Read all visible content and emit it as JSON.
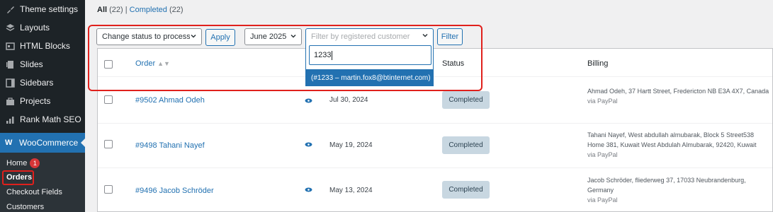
{
  "sidebar": {
    "items": [
      {
        "icon": "brush-icon",
        "label": "Theme settings"
      },
      {
        "icon": "layers-icon",
        "label": "Layouts"
      },
      {
        "icon": "html-blocks-icon",
        "label": "HTML Blocks"
      },
      {
        "icon": "slides-icon",
        "label": "Slides"
      },
      {
        "icon": "sidebars-icon",
        "label": "Sidebars"
      },
      {
        "icon": "projects-icon",
        "label": "Projects"
      },
      {
        "icon": "chart-icon",
        "label": "Rank Math SEO"
      }
    ],
    "woocommerce": {
      "icon": "woo-icon",
      "icon_text": "W",
      "label": "WooCommerce"
    },
    "submenu": {
      "home": "Home",
      "home_badge": "1",
      "orders": "Orders",
      "checkout_fields": "Checkout Fields",
      "customers": "Customers"
    }
  },
  "filters": {
    "all_label": "All",
    "all_count": "(22)",
    "separator": "|",
    "completed_label": "Completed",
    "completed_count": "(22)"
  },
  "tablenav": {
    "bulk_action": "Change status to processin",
    "apply": "Apply",
    "month": "June 2025",
    "customer_placeholder": "Filter by registered customer",
    "filter": "Filter",
    "search_value": "1233",
    "dropdown_option": "(#1233 – martin.fox8@btinternet.com)"
  },
  "table": {
    "headers": {
      "order": "Order",
      "status": "Status",
      "billing": "Billing"
    },
    "rows": [
      {
        "order": "#9502 Ahmad Odeh",
        "date": "Jul 30, 2024",
        "status": "Completed",
        "billing": "Ahmad Odeh, 37 Hartt Street, Fredericton NB E3A 4X7, Canada",
        "via": "via PayPal"
      },
      {
        "order": "#9498 Tahani Nayef",
        "date": "May 19, 2024",
        "status": "Completed",
        "billing": "Tahani Nayef, West abdullah almubarak, Block 5 Street538 Home 381, Kuwait West Abdulah Almubarak, 92420, Kuwait",
        "via": "via PayPal"
      },
      {
        "order": "#9496 Jacob Schröder",
        "date": "May 13, 2024",
        "status": "Completed",
        "billing": "Jacob Schröder, fliederweg 37, 17033 Neubrandenburg, Germany",
        "via": "via PayPal"
      }
    ]
  },
  "colors": {
    "accent": "#2271b1",
    "highlight": "#e0201c",
    "sidebar": "#1d2327",
    "status_completed": "#c8d7e1"
  }
}
